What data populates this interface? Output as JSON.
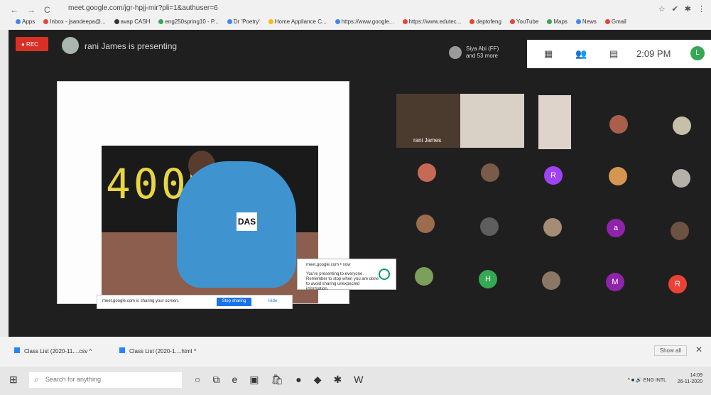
{
  "browser": {
    "nav": [
      "←",
      "→",
      "C"
    ],
    "url": "meet.google.com/jgr-hpjj-mir?pli=1&authuser=6",
    "top_icons": [
      "☆",
      "✔",
      "✱",
      "⋮"
    ],
    "bookmarks": [
      {
        "label": "Apps",
        "color": "#4285f4"
      },
      {
        "label": "Inbox - jsandeepa@...",
        "color": "#ea4335"
      },
      {
        "label": "avap CASH",
        "color": "#333333"
      },
      {
        "label": "eng250spring10 - P...",
        "color": "#34a853"
      },
      {
        "label": "Dr 'Poetry'",
        "color": "#4285f4"
      },
      {
        "label": "Home Appliance C...",
        "color": "#fbbc05"
      },
      {
        "label": "https://www.google...",
        "color": "#4285f4"
      },
      {
        "label": "https://www.edutec...",
        "color": "#ea4335"
      },
      {
        "label": "deptofeng",
        "color": "#ea4335"
      },
      {
        "label": "YouTube",
        "color": "#ea4335"
      },
      {
        "label": "Maps",
        "color": "#34a853"
      },
      {
        "label": "News",
        "color": "#4285f4"
      },
      {
        "label": "Gmail",
        "color": "#ea4335"
      }
    ]
  },
  "meet": {
    "rec_label": "● REC",
    "presenting_text": "rani James is presenting",
    "participants_text": "Siya Abi (FF)\nand 53 more",
    "controls": [
      "▦",
      "👥",
      "▤"
    ],
    "time": "2:09 PM",
    "self_initial": "L",
    "slide": {
      "scoreboard": "400M",
      "bib": "DAS",
      "share_text": "meet.google.com is sharing your screen.",
      "share_button": "Stop sharing",
      "hide_button": "Hide",
      "popup_title": "meet.google.com • now",
      "popup_body": "You're presenting to everyone. Remember to stop when you are done to avoid sharing unexpected information."
    },
    "tiles": [
      {
        "label": "rani James",
        "bg": "#4b3a2e"
      },
      {
        "label": "",
        "bg": "#d9d0c6"
      },
      {
        "label": "",
        "bg": "#ded4cb"
      }
    ],
    "avatars": [
      {
        "initial": "",
        "color": "#a95f4a"
      },
      {
        "initial": "",
        "color": "#c7c0a8"
      },
      {
        "initial": "",
        "color": "#c76a55"
      },
      {
        "initial": "",
        "color": "#7a5a48"
      },
      {
        "initial": "R",
        "color": "#a142f4"
      },
      {
        "initial": "",
        "color": "#d59650"
      },
      {
        "initial": "",
        "color": "#b5b0a8"
      },
      {
        "initial": "",
        "color": "#9b6d4e"
      },
      {
        "initial": "",
        "color": "#5e5e5e"
      },
      {
        "initial": "",
        "color": "#a58c75"
      },
      {
        "initial": "a",
        "color": "#8e24aa"
      },
      {
        "initial": "",
        "color": "#6d5142"
      },
      {
        "initial": "",
        "color": "#7ca05a"
      },
      {
        "initial": "H",
        "color": "#34a853"
      },
      {
        "initial": "",
        "color": "#8a7766"
      },
      {
        "initial": "M",
        "color": "#8e24aa"
      },
      {
        "initial": "R",
        "color": "#ea4335"
      }
    ]
  },
  "downloads": {
    "items": [
      "Class List (2020-11....csv",
      "Class List (2020-1....html"
    ],
    "show_all": "Show all",
    "close": "✕"
  },
  "taskbar": {
    "start_icon": "⊞",
    "search_placeholder": "Search for anything",
    "app_icons": [
      "○",
      "⧉",
      "e",
      "▣",
      "🛍",
      "●",
      "◆",
      "✱",
      "W"
    ],
    "tray": "^ ■ 🔊 ENG INTL",
    "clock_time": "14:09",
    "clock_date": "26-11-2020"
  }
}
